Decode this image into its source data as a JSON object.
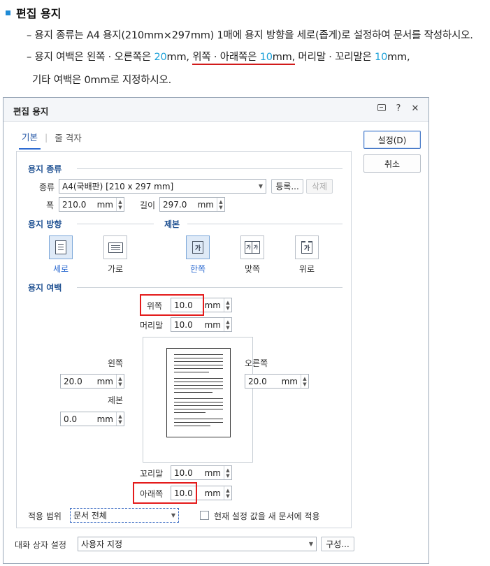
{
  "instructions": {
    "title": "편집 용지",
    "line1": "– 용지 종류는 A4 용지(210mm×297mm) 1매에 용지 방향을 세로(좁게)로 설정하여 문서를 작성하시오.",
    "line2_a": "– 용지 여백은 왼쪽 · 오른쪽은 ",
    "line2_b": "20",
    "line2_c": "mm,",
    "line2_d": "위쪽 · 아래쪽은 ",
    "line2_e": "10",
    "line2_f": "mm,",
    "line2_g": " 머리말 · 꼬리말은 ",
    "line2_h": "10",
    "line2_i": "mm,",
    "line3": "기타 여백은 0mm로 지정하시오."
  },
  "dialog": {
    "title": "편집 용지",
    "tabs": [
      "기본",
      "줄 격자"
    ],
    "tab_sep": "|",
    "buttons": {
      "ok": "설정(D)",
      "cancel": "취소",
      "register": "등록...",
      "delete": "삭제",
      "compose": "구성..."
    },
    "paper": {
      "section": "용지 종류",
      "type_label": "종류",
      "type_value": "A4(국배판) [210 x 297 mm]",
      "width_label": "폭",
      "width_value": "210.0",
      "length_label": "길이",
      "length_value": "297.0",
      "unit": "mm"
    },
    "orientation": {
      "section": "용지 방향",
      "options": [
        "세로",
        "가로"
      ],
      "selected": "세로"
    },
    "binding": {
      "section": "제본",
      "options": [
        "한쪽",
        "맞쪽",
        "위로"
      ],
      "selected": "한쪽",
      "icon_text": "가"
    },
    "margins": {
      "section": "용지 여백",
      "top_label": "위쪽",
      "top_value": "10.0",
      "header_label": "머리말",
      "header_value": "10.0",
      "left_label": "왼쪽",
      "left_value": "20.0",
      "right_label": "오른쪽",
      "right_value": "20.0",
      "binding_label": "제본",
      "binding_value": "0.0",
      "footer_label": "꼬리말",
      "footer_value": "10.0",
      "bottom_label": "아래쪽",
      "bottom_value": "10.0",
      "unit": "mm"
    },
    "scope": {
      "label": "적용 범위",
      "value": "문서 전체"
    },
    "apply_new": {
      "label": "현재 설정 값을 새 문서에 적용",
      "checked": false
    },
    "dialog_setting": {
      "label": "대화 상자 설정",
      "value": "사용자 지정"
    }
  },
  "colors": {
    "accent_blue": "#1aa0d8",
    "red_box": "#e41b1b",
    "section_blue": "#1d4f91"
  }
}
